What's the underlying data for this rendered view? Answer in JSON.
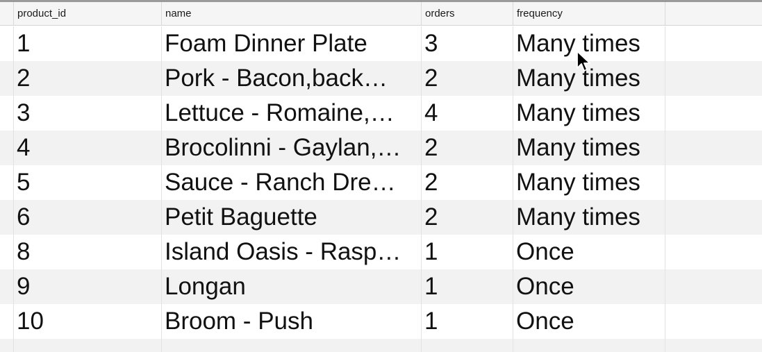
{
  "table": {
    "columns": [
      "product_id",
      "name",
      "orders",
      "frequency"
    ],
    "rows": [
      {
        "product_id": "1",
        "name": "Foam Dinner Plate",
        "orders": "3",
        "frequency": "Many times"
      },
      {
        "product_id": "2",
        "name": "Pork - Bacon,back…",
        "orders": "2",
        "frequency": "Many times"
      },
      {
        "product_id": "3",
        "name": "Lettuce - Romaine,…",
        "orders": "4",
        "frequency": "Many times"
      },
      {
        "product_id": "4",
        "name": "Brocolinni - Gaylan,…",
        "orders": "2",
        "frequency": "Many times"
      },
      {
        "product_id": "5",
        "name": "Sauce - Ranch Dre…",
        "orders": "2",
        "frequency": "Many times"
      },
      {
        "product_id": "6",
        "name": "Petit Baguette",
        "orders": "2",
        "frequency": "Many times"
      },
      {
        "product_id": "8",
        "name": "Island Oasis - Rasp…",
        "orders": "1",
        "frequency": "Once"
      },
      {
        "product_id": "9",
        "name": "Longan",
        "orders": "1",
        "frequency": "Once"
      },
      {
        "product_id": "10",
        "name": "Broom - Push",
        "orders": "1",
        "frequency": "Once"
      }
    ]
  },
  "colors": {
    "row_alt": "#f2f2f2",
    "header_bg": "#f5f5f5",
    "text": "#111111"
  },
  "icons": {
    "cursor": "mouse-pointer-icon"
  }
}
